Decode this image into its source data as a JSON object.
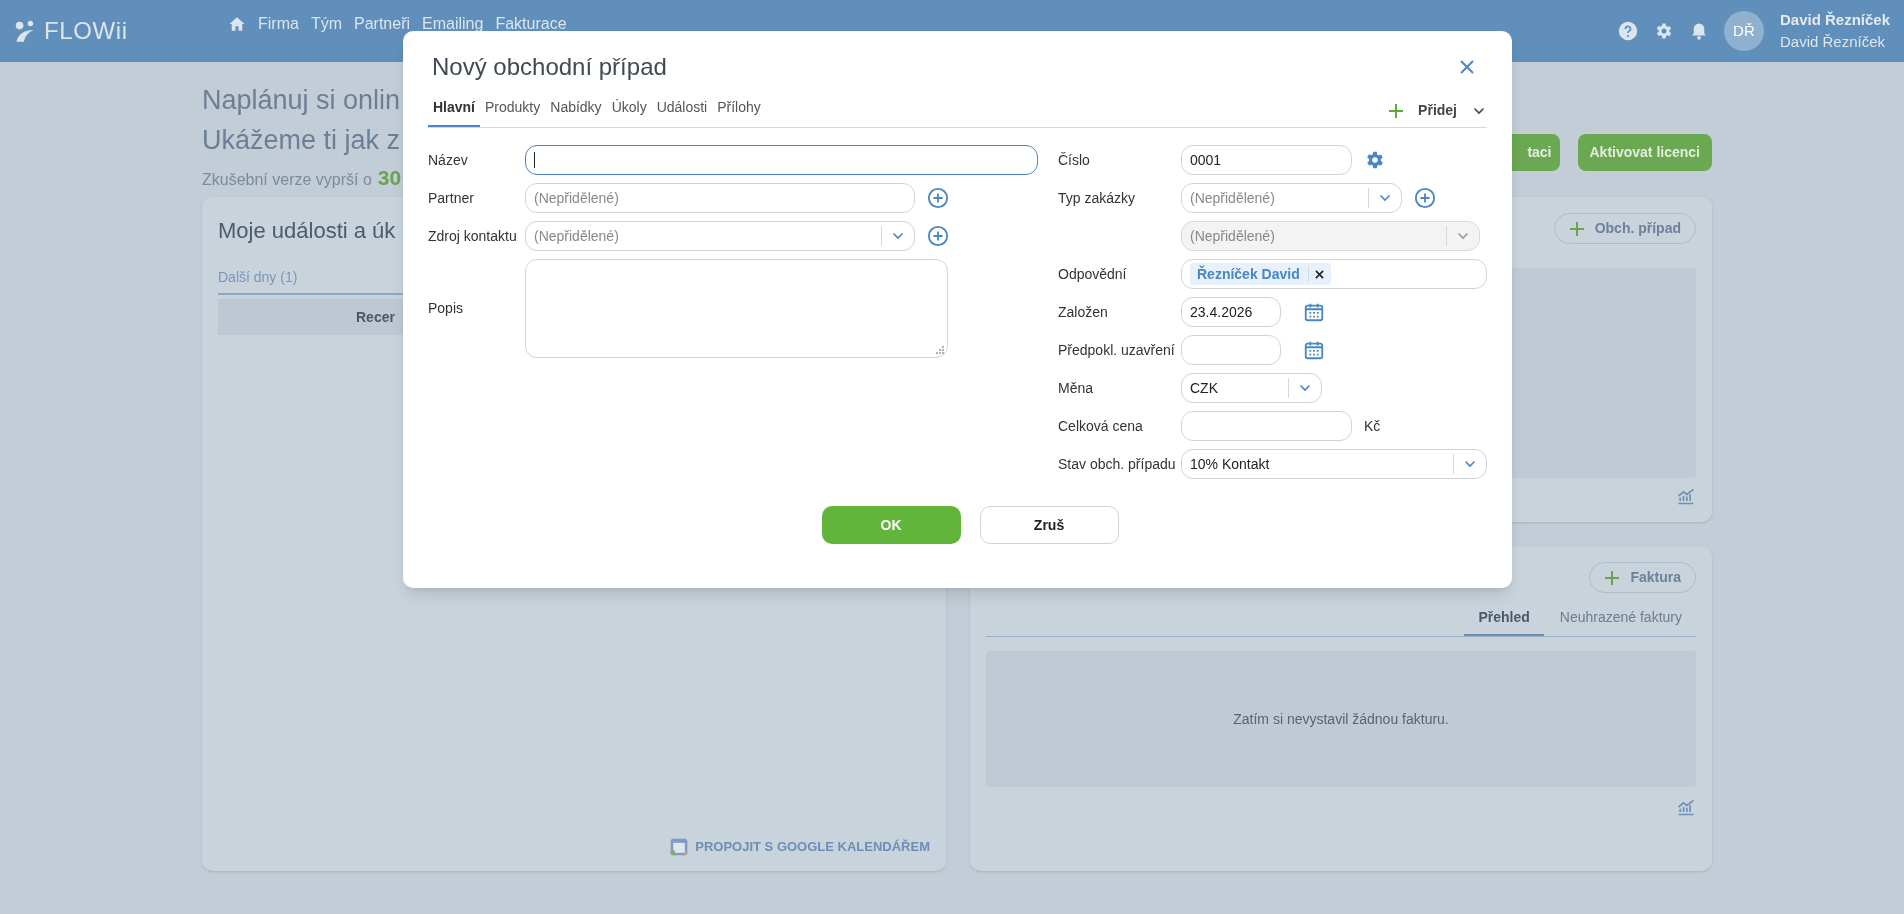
{
  "header": {
    "logo": "FLOWii",
    "nav": [
      "Firma",
      "Tým",
      "Partneři",
      "Emailing",
      "Fakturace"
    ],
    "user_initials": "DŘ",
    "user_name": "David Řezníček",
    "user_company": "David Řezníček"
  },
  "background": {
    "promo_lines": [
      "Naplánuj si onlin",
      "Ukážeme ti jak z"
    ],
    "trial_text": "Zkušební verze vyprší o",
    "trial_days": "30",
    "promo_buttons": [
      "taci",
      "Aktivovat licenci"
    ],
    "events_card": {
      "title": "Moje události a úk",
      "tab": "Další dny (1)",
      "row": "Recer",
      "link": "PROPOJIT S GOOGLE KALENDÁŘEM"
    },
    "deals_card": {
      "button": "Obch. případ"
    },
    "invoices_card": {
      "button": "Faktura",
      "tabs": [
        {
          "label": "Přehled",
          "selected": true
        },
        {
          "label": "Neuhrazené faktury",
          "selected": false
        }
      ],
      "empty_text": "Zatím si nevystavil žádnou fakturu."
    }
  },
  "dialog": {
    "title": "Nový obchodní případ",
    "tabs": [
      {
        "label": "Hlavní",
        "selected": true
      },
      {
        "label": "Produkty",
        "selected": false
      },
      {
        "label": "Nabídky",
        "selected": false
      },
      {
        "label": "Úkoly",
        "selected": false
      },
      {
        "label": "Události",
        "selected": false
      },
      {
        "label": "Přílohy",
        "selected": false
      }
    ],
    "add_button": "Přidej",
    "left_fields": [
      {
        "label": "Název",
        "kind": "text",
        "focused": true
      },
      {
        "label": "Partner",
        "kind": "text",
        "placeholder": "(Nepřidělené)",
        "add": true,
        "focused": false
      },
      {
        "label": "Zdroj kontaktu",
        "kind": "select",
        "placeholder": "(Nepřidělené)",
        "add": true,
        "disabled": false
      },
      {
        "label": "Popis",
        "kind": "textarea"
      }
    ],
    "right_fields": [
      {
        "label": "Číslo",
        "kind": "text",
        "value": "0001",
        "settings": true
      },
      {
        "label": "Typ zakázky",
        "kind": "select",
        "placeholder": "(Nepřidělené)",
        "add": true,
        "disabled": false
      },
      {
        "kind": "select",
        "placeholder": "(Nepřidělené)",
        "disabled": true
      },
      {
        "label": "Odpovědní",
        "kind": "tags",
        "tags": [
          "Řezníček David"
        ]
      },
      {
        "label": "Založen",
        "kind": "date",
        "value": "23.4.2026"
      },
      {
        "label": "Předpokl. uzavření",
        "kind": "date"
      },
      {
        "label": "Měna",
        "kind": "select",
        "value": "CZK",
        "disabled": false
      },
      {
        "label": "Celková cena",
        "kind": "text",
        "unit": "Kč"
      },
      {
        "label": "Stav obch. případu",
        "kind": "select",
        "value": "10% Kontakt",
        "disabled": false
      }
    ],
    "buttons": [
      "OK",
      "Zruš"
    ]
  }
}
